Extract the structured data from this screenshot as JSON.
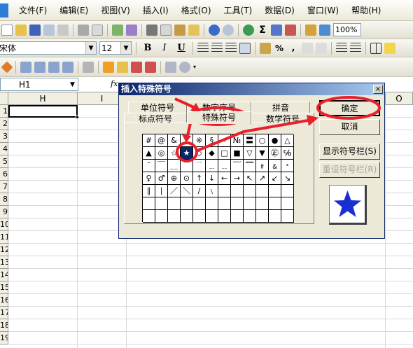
{
  "menu": {
    "items": [
      "文件(F)",
      "编辑(E)",
      "视图(V)",
      "插入(I)",
      "格式(O)",
      "工具(T)",
      "数据(D)",
      "窗口(W)",
      "帮助(H)"
    ]
  },
  "toolbar": {
    "zoom": "100%",
    "font_name": "宋体",
    "font_size": "12",
    "bold_label": "B",
    "italic_label": "I",
    "underline_label": "U",
    "percent_label": "%",
    "comma_label": ","
  },
  "formula_bar": {
    "name_box": "H1",
    "fx_label": "fx"
  },
  "sheet": {
    "columns": [
      "H",
      "I",
      "O"
    ],
    "rows": [
      "1",
      "2",
      "3",
      "4",
      "5",
      "6",
      "7",
      "8",
      "9",
      "10",
      "11",
      "12",
      "13",
      "14",
      "15",
      "16",
      "17",
      "18",
      "19"
    ]
  },
  "dialog": {
    "title": "插入特殊符号",
    "close_label": "×",
    "tabs": [
      "单位符号",
      "数字序号",
      "拼音",
      "标点符号",
      "特殊符号",
      "数学符号"
    ],
    "active_tab": "特殊符号",
    "symbols": [
      [
        "#",
        "@",
        "&",
        "*",
        "※",
        "§",
        "〃",
        "№",
        "〓",
        "○",
        "●",
        "△"
      ],
      [
        "▲",
        "◎",
        "☆",
        "★",
        "◇",
        "◆",
        "□",
        "■",
        "▽",
        "▼",
        "㊣",
        "℅"
      ],
      [
        "ˉ",
        "￣",
        "＿",
        "﹉",
        "﹊",
        "﹍",
        "﹎",
        "﹋",
        "﹌",
        "﹟",
        "﹠",
        "﹡"
      ],
      [
        "♀",
        "♂",
        "⊕",
        "⊙",
        "↑",
        "↓",
        "←",
        "→",
        "↖",
        "↗",
        "↙",
        "↘"
      ],
      [
        "∥",
        "∣",
        "／",
        "＼",
        "∕",
        "﹨",
        "",
        "",
        "",
        "",
        "",
        ""
      ],
      [
        "",
        "",
        "",
        "",
        "",
        "",
        "",
        "",
        "",
        "",
        "",
        ""
      ],
      [
        "",
        "",
        "",
        "",
        "",
        "",
        "",
        "",
        "",
        "",
        "",
        ""
      ]
    ],
    "selected_symbol": "★",
    "buttons": {
      "ok": "确定",
      "cancel": "取消",
      "show_bar": "显示符号栏(S)",
      "reset_bar": "重设符号栏(R)"
    },
    "preview_symbol": "★"
  },
  "colors": {
    "annotation": "#e8202c",
    "selection": "#0a246a",
    "preview_star": "#1a2ed6"
  }
}
